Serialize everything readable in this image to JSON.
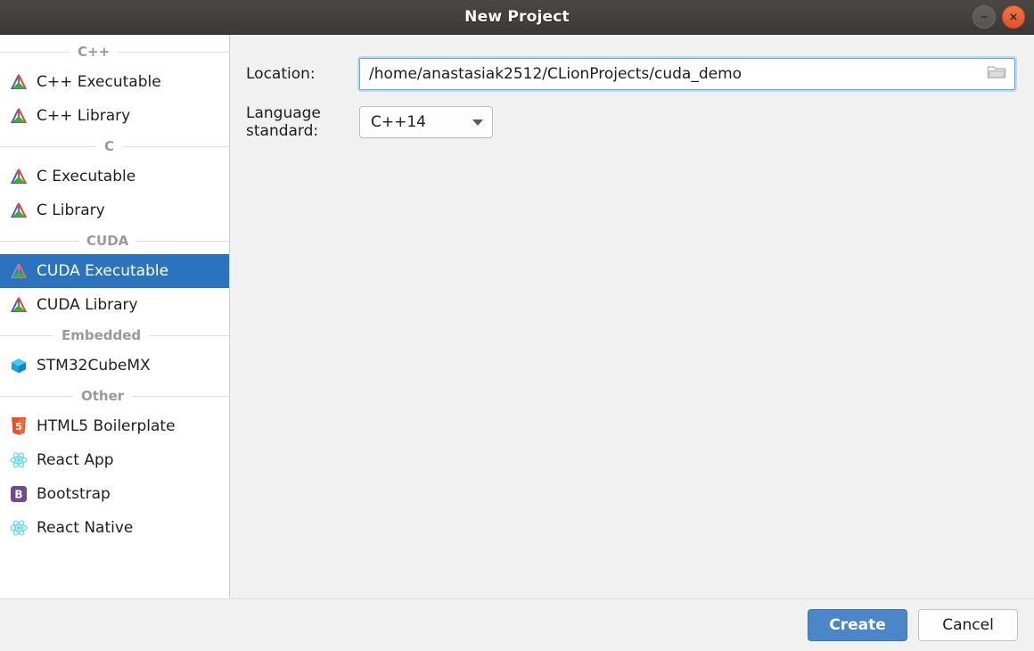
{
  "window": {
    "title": "New Project",
    "minimize_icon": "minimize-icon",
    "close_icon": "close-icon"
  },
  "sidebar": {
    "sections": [
      {
        "label": "C++",
        "items": [
          {
            "label": "C++ Executable",
            "icon": "clion-triangle-icon",
            "selected": false
          },
          {
            "label": "C++ Library",
            "icon": "clion-triangle-icon",
            "selected": false
          }
        ]
      },
      {
        "label": "C",
        "items": [
          {
            "label": "C Executable",
            "icon": "clion-triangle-icon",
            "selected": false
          },
          {
            "label": "C Library",
            "icon": "clion-triangle-icon",
            "selected": false
          }
        ]
      },
      {
        "label": "CUDA",
        "items": [
          {
            "label": "CUDA Executable",
            "icon": "clion-triangle-icon",
            "selected": true
          },
          {
            "label": "CUDA Library",
            "icon": "clion-triangle-icon",
            "selected": false
          }
        ]
      },
      {
        "label": "Embedded",
        "items": [
          {
            "label": "STM32CubeMX",
            "icon": "cube-icon",
            "selected": false
          }
        ]
      },
      {
        "label": "Other",
        "items": [
          {
            "label": "HTML5 Boilerplate",
            "icon": "html5-icon",
            "selected": false
          },
          {
            "label": "React App",
            "icon": "react-icon",
            "selected": false
          },
          {
            "label": "Bootstrap",
            "icon": "bootstrap-icon",
            "selected": false
          },
          {
            "label": "React Native",
            "icon": "react-icon",
            "selected": false
          }
        ]
      }
    ]
  },
  "form": {
    "location": {
      "label": "Location:",
      "value": "/home/anastasiak2512/CLionProjects/cuda_demo",
      "placeholder": "/home/anastasiak2512/CLionProjects/cuda_demo",
      "browse_icon": "folder-icon"
    },
    "language_standard": {
      "label": "Language standard:",
      "value": "C++14",
      "dropdown_icon": "chevron-down-icon"
    }
  },
  "footer": {
    "create_label": "Create",
    "cancel_label": "Cancel"
  },
  "colors": {
    "selection_blue": "#2b73bd",
    "primary_button": "#4a86c8",
    "titlebar": "#403d3a",
    "close_button": "#e2512c",
    "panel_background": "#f1f1f1"
  }
}
